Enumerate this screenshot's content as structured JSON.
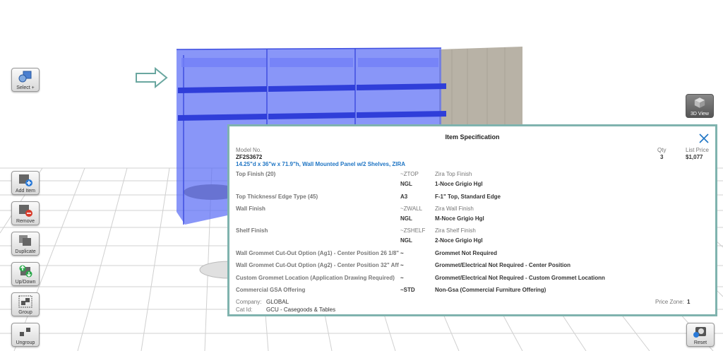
{
  "toolbar": {
    "select": "Select +",
    "add_item": "Add Item",
    "remove": "Remove",
    "duplicate": "Duplicate",
    "up_down": "Up/Down",
    "group": "Group",
    "ungroup": "Ungroup",
    "view_3d": "3D View",
    "reset": "Reset"
  },
  "spec": {
    "title": "Item Specification",
    "model_label": "Model No.",
    "model_no": "ZF2S3672",
    "description": "14.25\"d x 36\"w x 71.9\"h, Wall Mounted Panel w/2 Shelves, ZIRA",
    "qty_label": "Qty",
    "qty": "3",
    "price_label": "List Price",
    "price": "$1,077",
    "options": [
      {
        "name": "Top Finish (20)",
        "code1": "~ZTOP",
        "desc1": "Zira Top Finish",
        "code2": "NGL",
        "desc2": "1-Noce Grigio Hgl"
      },
      {
        "name": "Top Thickness/ Edge Type (45)",
        "code": "A3",
        "desc": "F-1\" Top, Standard Edge"
      },
      {
        "name": "Wall Finish",
        "code1": "~ZWALL",
        "desc1": "Zira Wall Finish",
        "code2": "NGL",
        "desc2": "M-Noce Grigio Hgl"
      },
      {
        "name": "Shelf Finish",
        "code1": "~ZSHELF",
        "desc1": "Zira Shelf Finish",
        "code2": "NGL",
        "desc2": "2-Noce Grigio Hgl"
      },
      {
        "name": "Wall Grommet Cut-Out Option (Ag1) - Center Position 26 1/8\"",
        "code": "~",
        "desc": "Grommet Not Required"
      },
      {
        "name": "Wall Grommet Cut-Out Option (Ag2) - Center Position 32\" Aff",
        "code": "~",
        "desc": "Grommet/Electrical Not Required - Center Position"
      },
      {
        "name": "Custom Grommet Location (Application Drawing Required)",
        "code": "~",
        "desc": "Grommet/Electrical Not Required - Custom Grommet Locationn"
      },
      {
        "name": "Commercial GSA Offering",
        "code": "~STD",
        "desc": "Non-Gsa (Commercial Furniture Offering)"
      }
    ],
    "company_label": "Company:",
    "company": "GLOBAL",
    "cat_label": "Cat Id:",
    "cat": "GCU - Casegoods & Tables",
    "zone_label": "Price Zone:",
    "zone": "1"
  },
  "colors": {
    "accent": "#7fb3ae",
    "link_blue": "#1f75c4",
    "selection_blue": "#5b6ef5",
    "wood": "#b8b2a6"
  }
}
